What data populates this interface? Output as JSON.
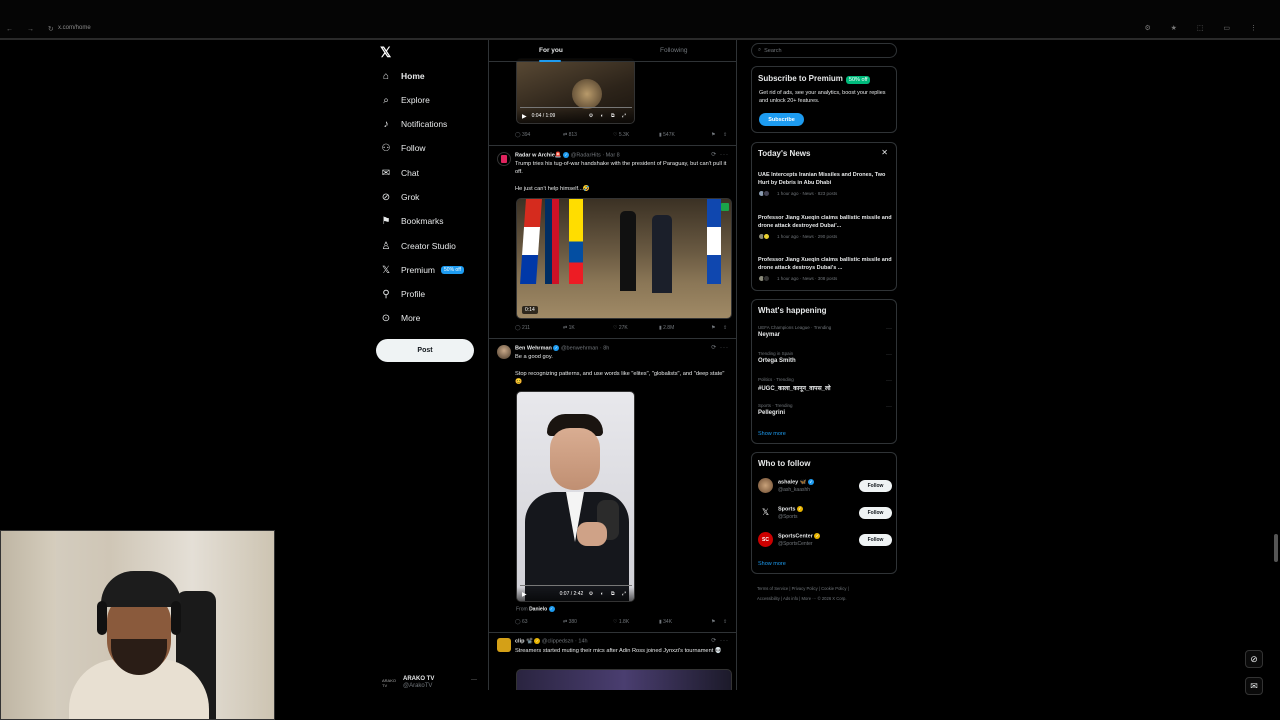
{
  "browser": {
    "address": "x.com/home"
  },
  "nav": {
    "items": [
      {
        "label": "Home",
        "icon": "home-icon",
        "glyph": "⌂"
      },
      {
        "label": "Explore",
        "icon": "search-icon",
        "glyph": "⌕"
      },
      {
        "label": "Notifications",
        "icon": "bell-icon",
        "glyph": "🔔"
      },
      {
        "label": "Follow",
        "icon": "add-person-icon",
        "glyph": "⚇"
      },
      {
        "label": "Chat",
        "icon": "mail-icon",
        "glyph": "✉"
      },
      {
        "label": "Grok",
        "icon": "grok-icon",
        "glyph": "⊘"
      },
      {
        "label": "Bookmarks",
        "icon": "bookmark-icon",
        "glyph": "🔖"
      },
      {
        "label": "Creator Studio",
        "icon": "creator-icon",
        "glyph": "♙"
      },
      {
        "label": "Premium",
        "icon": "x-logo-icon",
        "glyph": "𝕏"
      },
      {
        "label": "Profile",
        "icon": "person-icon",
        "glyph": "⚲"
      },
      {
        "label": "More",
        "icon": "more-circle-icon",
        "glyph": "⊙"
      }
    ],
    "premium_badge": "50% off",
    "post_label": "Post",
    "account_name": "ARAKO TV",
    "account_handle": "@ArakoTV",
    "account_avatar_text": "ARAKO TV"
  },
  "feed": {
    "tabs": [
      "For you",
      "Following"
    ],
    "tweet1": {
      "video_time": "0:04 / 1:09",
      "stats": {
        "replies": "394",
        "reposts": "813",
        "likes": "5.3K",
        "views": "547K"
      }
    },
    "tweet2": {
      "name": "Radar w Archie🚨",
      "handle": "@RadarHits · Mar 8",
      "text": "Trump tries his tug-of-war handshake with the president of Paraguay, but can't pull it off.",
      "text2": "He just can't help himself...🤣",
      "video_duration": "0:14",
      "stats": {
        "replies": "211",
        "reposts": "1K",
        "likes": "27K",
        "views": "2.8M"
      }
    },
    "tweet3": {
      "name": "Ben Wehrman",
      "handle": "@benwehrman · 8h",
      "text": "Be a good goy.",
      "text2": "Stop recognizing patterns, and use words like \"elites\", \"globalists\", and \"deep state\" 😊",
      "video_time": "0:07 / 2:42",
      "from_label": "From",
      "from_name": "Danielo",
      "stats": {
        "replies": "63",
        "reposts": "380",
        "likes": "1.8K",
        "views": "34K"
      }
    },
    "tweet4": {
      "name": "clip 📽️",
      "handle": "@clippedszn · 14h",
      "text": "Streamers started muting their mics after Adin Ross joined Jynxzi's tournament 💀"
    }
  },
  "right": {
    "search_placeholder": "Search",
    "premium": {
      "title": "Subscribe to Premium",
      "badge": "50% off",
      "text": "Get rid of ads, see your analytics, boost your replies and unlock 20+ features.",
      "button": "Subscribe"
    },
    "news": {
      "title": "Today's News",
      "items": [
        {
          "title": "UAE Intercepts Iranian Missiles and Drones, Two Hurt by Debris in Abu Dhabi",
          "meta": "1 hour ago · News · 823 posts"
        },
        {
          "title": "Professor Jiang Xueqin claims ballistic missile and drone attack destroyed Dubai'...",
          "meta": "1 hour ago · News · 290 posts"
        },
        {
          "title": "Professor Jiang Xueqin claims ballistic missile and drone attack destroys Dubai's ...",
          "meta": "1 hour ago · News · 308 posts"
        }
      ]
    },
    "happening": {
      "title": "What's happening",
      "items": [
        {
          "context": "UEFA Champions League · Trending",
          "topic": "Neymar"
        },
        {
          "context": "Trending in Spain",
          "topic": "Ortega Smith"
        },
        {
          "context": "Politics · Trending",
          "topic": "#UGC_काला_कानून_वापस_लो"
        },
        {
          "context": "Sports · Trending",
          "topic": "Pellegrini"
        }
      ],
      "show_more": "Show more"
    },
    "who_to_follow": {
      "title": "Who to follow",
      "items": [
        {
          "name": "ashaley 🦋",
          "handle": "@ash_kaashh"
        },
        {
          "name": "Sports",
          "handle": "@Sports"
        },
        {
          "name": "SportsCenter",
          "handle": "@SportsCenter"
        }
      ],
      "follow_label": "Follow",
      "show_more": "Show more"
    },
    "footer": {
      "line1": "Terms of Service  |  Privacy Policy  |  Cookie Policy  |",
      "line2": "Accessibility  |  Ads info  |  More ···  © 2026 X Corp."
    }
  }
}
